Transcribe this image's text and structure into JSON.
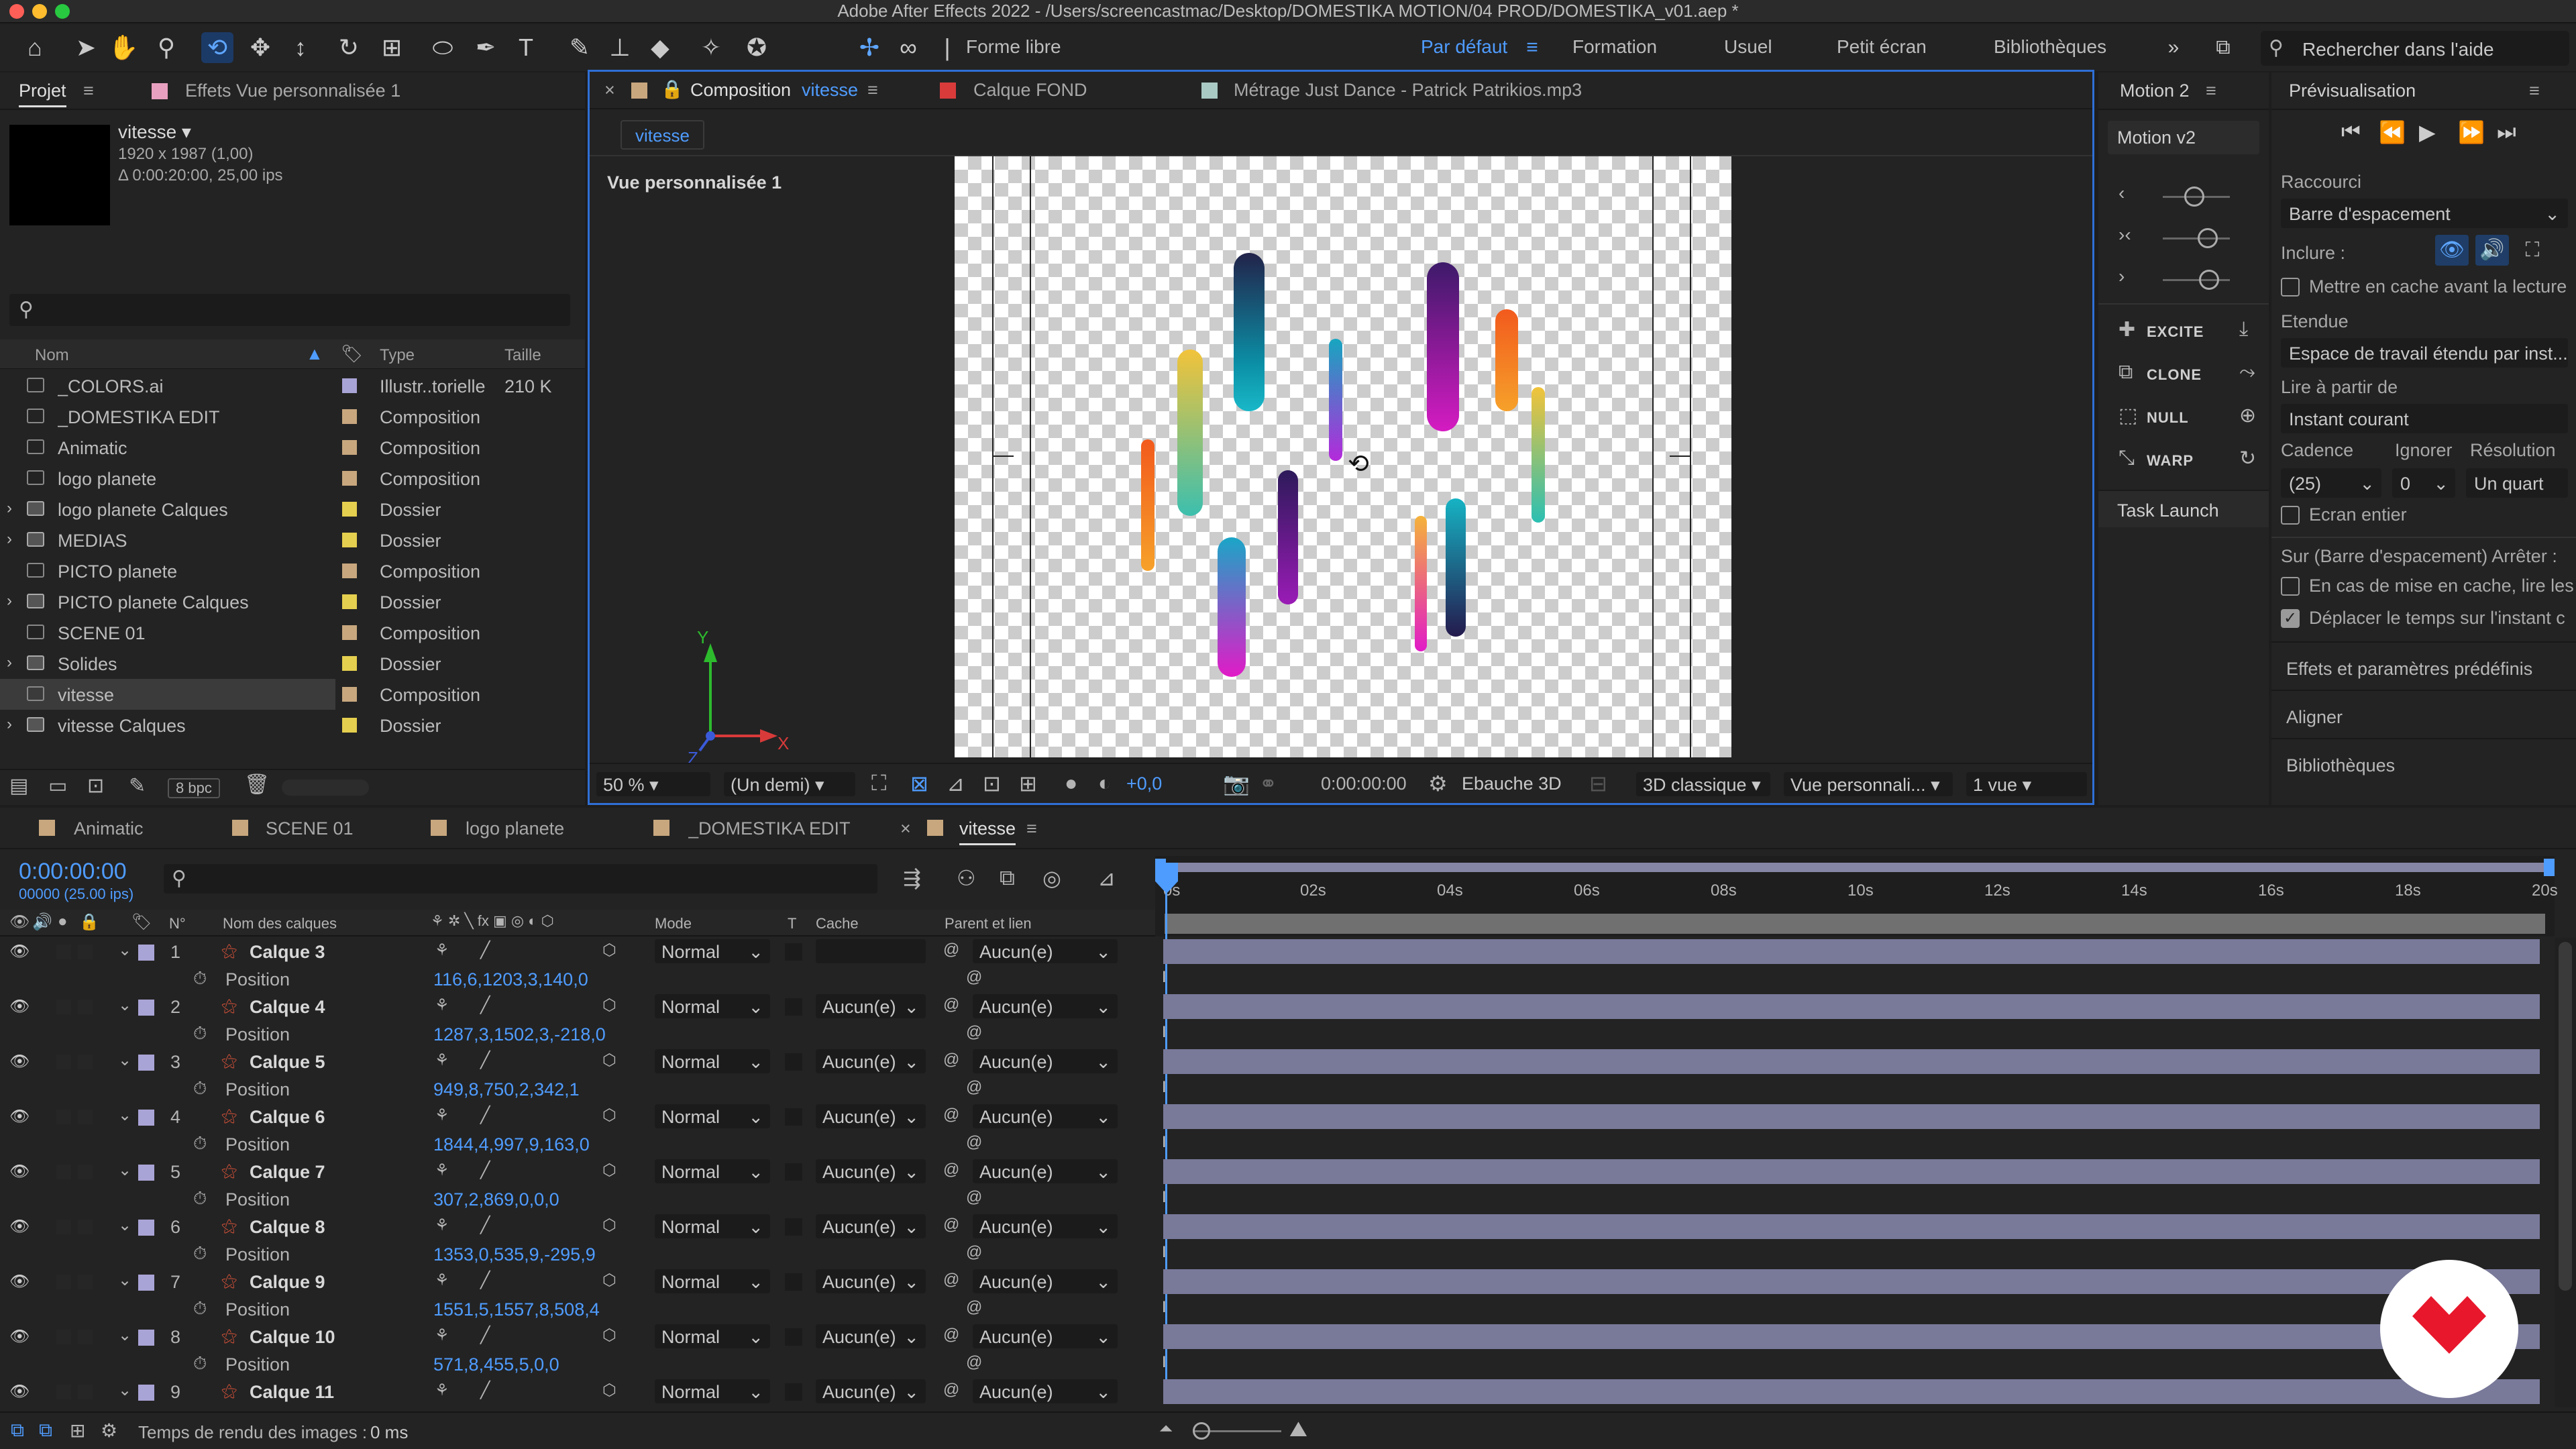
{
  "app": {
    "title": "Adobe After Effects 2022 - /Users/screencastmac/Desktop/DOMESTIKA MOTION/04 PROD/DOMESTIKA_v01.aep *"
  },
  "toolbar": {
    "shape_label": "Forme libre",
    "workspaces": [
      "Par défaut",
      "Formation",
      "Usuel",
      "Petit écran",
      "Bibliothèques"
    ],
    "help_placeholder": "Rechercher dans l'aide"
  },
  "project": {
    "tab_label": "Projet",
    "effects_tab": "Effets Vue personnalisée 1",
    "selected": {
      "name": "vitesse ▾",
      "dims": "1920 x 1987 (1,00)",
      "duration": "Δ 0:00:20:00, 25,00 ips"
    },
    "columns": {
      "name": "Nom",
      "type": "Type",
      "size": "Taille"
    },
    "items": [
      {
        "name": "_COLORS.ai",
        "type": "Illustr..torielle",
        "size": "210 K",
        "label_color": "#a9a4d6"
      },
      {
        "name": "_DOMESTIKA EDIT",
        "type": "Composition",
        "size": "",
        "label_color": "#c8a77e"
      },
      {
        "name": "Animatic",
        "type": "Composition",
        "size": "",
        "label_color": "#c8a77e"
      },
      {
        "name": "logo planete",
        "type": "Composition",
        "size": "",
        "label_color": "#c8a77e"
      },
      {
        "name": "logo planete Calques",
        "type": "Dossier",
        "size": "",
        "label_color": "#e5cf4e"
      },
      {
        "name": "MEDIAS",
        "type": "Dossier",
        "size": "",
        "label_color": "#e5cf4e"
      },
      {
        "name": "PICTO planete",
        "type": "Composition",
        "size": "",
        "label_color": "#c8a77e"
      },
      {
        "name": "PICTO planete Calques",
        "type": "Dossier",
        "size": "",
        "label_color": "#e5cf4e"
      },
      {
        "name": "SCENE 01",
        "type": "Composition",
        "size": "",
        "label_color": "#c8a77e"
      },
      {
        "name": "Solides",
        "type": "Dossier",
        "size": "",
        "label_color": "#e5cf4e"
      },
      {
        "name": "vitesse",
        "type": "Composition",
        "size": "",
        "label_color": "#c8a77e"
      },
      {
        "name": "vitesse Calques",
        "type": "Dossier",
        "size": "",
        "label_color": "#e5cf4e"
      }
    ],
    "bpc": "8 bpc"
  },
  "viewer": {
    "tabs": [
      "Composition",
      "vitesse",
      "Calque FOND",
      "Métrage Just Dance - Patrick Patrikios.mp3"
    ],
    "sub_tab": "vitesse",
    "view_name": "Vue personnalisée 1",
    "zoom": "50 %",
    "resolution": "(Un demi)",
    "exposure": "+0,0",
    "timecode": "0:00:00:00",
    "draft": "Ebauche 3D",
    "renderer": "3D classique",
    "view": "Vue personnali...",
    "views_count": "1 vue"
  },
  "motion": {
    "tab": "Motion 2",
    "preset": "Motion v2",
    "buttons": [
      "EXCITE",
      "CLONE",
      "NULL",
      "WARP"
    ],
    "task": "Task Launch"
  },
  "preview": {
    "tab": "Prévisualisation",
    "shortcut_label": "Raccourci",
    "shortcut_value": "Barre d'espacement",
    "include_label": "Inclure :",
    "cache_label": "Mettre en cache avant la lecture",
    "range_label": "Etendue",
    "range_value": "Espace de travail étendu par inst...",
    "from_label": "Lire à partir de",
    "from_value": "Instant courant",
    "cadence_label": "Cadence",
    "ignore_label": "Ignorer",
    "resolution_label": "Résolution",
    "cadence_value": "(25)",
    "ignore_value": "0",
    "resolution_value": "Un quart",
    "fullscreen_label": "Ecran entier",
    "on_stop_label": "Sur (Barre d'espacement) Arrêter :",
    "cache_stop_label": "En cas de mise en cache, lire les",
    "move_time_label": "Déplacer le temps sur l'instant c",
    "panels": [
      "Effets et paramètres prédéfinis",
      "Aligner",
      "Bibliothèques"
    ]
  },
  "timeline": {
    "tabs": [
      "Animatic",
      "SCENE 01",
      "logo planete",
      "_DOMESTIKA EDIT",
      "vitesse"
    ],
    "current_time": "0:00:00:00",
    "frame_info": "00000 (25.00 ips)",
    "columns": {
      "num": "N°",
      "layer_name": "Nom des calques",
      "mode": "Mode",
      "t": "T",
      "cache": "Cache",
      "parent": "Parent et lien"
    },
    "ruler": [
      "0s",
      "02s",
      "04s",
      "06s",
      "08s",
      "10s",
      "12s",
      "14s",
      "16s",
      "18s",
      "20s"
    ],
    "layers": [
      {
        "num": "1",
        "name": "Calque 3",
        "mode": "Normal",
        "cache": "",
        "parent": "Aucun(e)",
        "prop": "Position",
        "value": "116,6,1203,3,140,0"
      },
      {
        "num": "2",
        "name": "Calque 4",
        "mode": "Normal",
        "cache": "Aucun(e)",
        "parent": "Aucun(e)",
        "prop": "Position",
        "value": "1287,3,1502,3,-218,0"
      },
      {
        "num": "3",
        "name": "Calque 5",
        "mode": "Normal",
        "cache": "Aucun(e)",
        "parent": "Aucun(e)",
        "prop": "Position",
        "value": "949,8,750,2,342,1"
      },
      {
        "num": "4",
        "name": "Calque 6",
        "mode": "Normal",
        "cache": "Aucun(e)",
        "parent": "Aucun(e)",
        "prop": "Position",
        "value": "1844,4,997,9,163,0"
      },
      {
        "num": "5",
        "name": "Calque 7",
        "mode": "Normal",
        "cache": "Aucun(e)",
        "parent": "Aucun(e)",
        "prop": "Position",
        "value": "307,2,869,0,0,0"
      },
      {
        "num": "6",
        "name": "Calque 8",
        "mode": "Normal",
        "cache": "Aucun(e)",
        "parent": "Aucun(e)",
        "prop": "Position",
        "value": "1353,0,535,9,-295,9"
      },
      {
        "num": "7",
        "name": "Calque 9",
        "mode": "Normal",
        "cache": "Aucun(e)",
        "parent": "Aucun(e)",
        "prop": "Position",
        "value": "1551,5,1557,8,508,4"
      },
      {
        "num": "8",
        "name": "Calque 10",
        "mode": "Normal",
        "cache": "Aucun(e)",
        "parent": "Aucun(e)",
        "prop": "Position",
        "value": "571,8,455,5,0,0"
      },
      {
        "num": "9",
        "name": "Calque 11",
        "mode": "Normal",
        "cache": "Aucun(e)",
        "parent": "Aucun(e)",
        "prop": "",
        "value": ""
      }
    ],
    "render_time_label": "Temps de rendu des images :",
    "render_time_value": "0 ms"
  },
  "colors": {
    "accent": "#2f86ff",
    "panel": "#232323",
    "layer_label": "#a9a4d6",
    "track": "#79799a",
    "logo": "#e8172c"
  }
}
